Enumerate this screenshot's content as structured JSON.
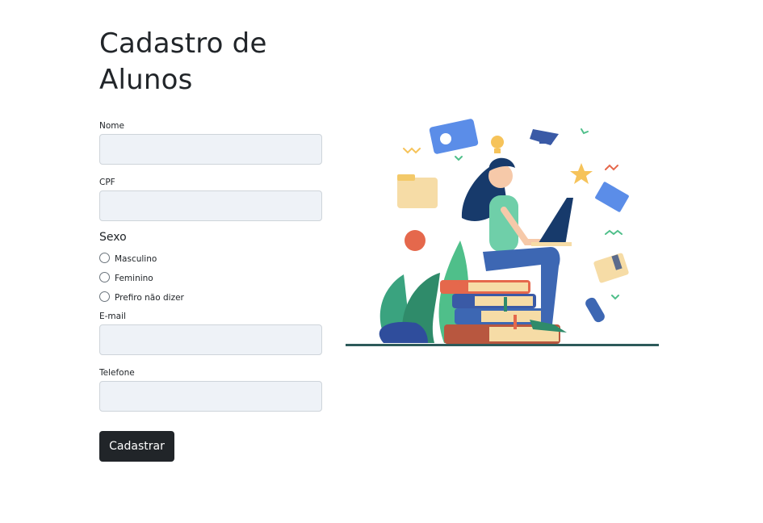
{
  "page": {
    "title": "Cadastro de Alunos"
  },
  "form": {
    "nome_label": "Nome",
    "cpf_label": "CPF",
    "sexo_label": "Sexo",
    "sexo_options": [
      "Masculino",
      "Feminino",
      "Prefiro não dizer"
    ],
    "email_label": "E-mail",
    "telefone_label": "Telefone",
    "submit_label": "Cadastrar"
  },
  "colors": {
    "input_bg": "#eef2f7",
    "button_bg": "#212529",
    "illustration_ground": "#2d5a5a"
  }
}
